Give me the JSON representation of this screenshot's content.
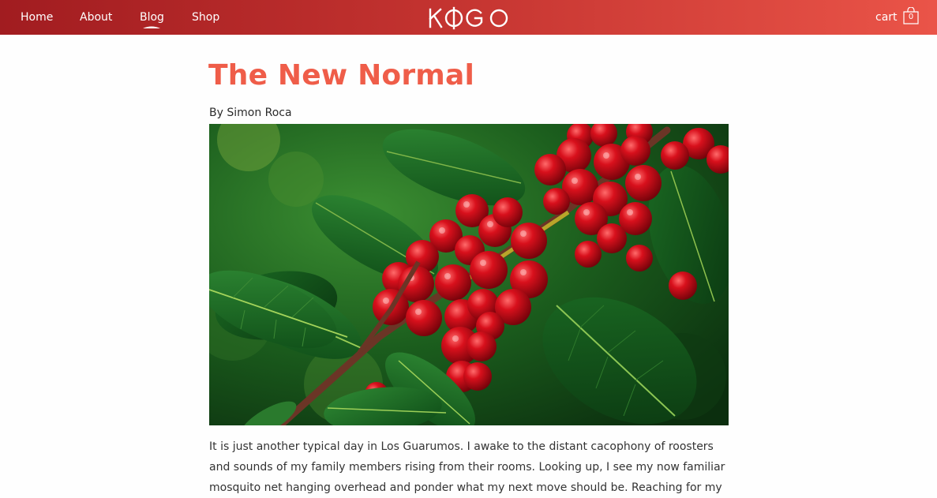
{
  "nav": {
    "items": [
      {
        "label": "Home"
      },
      {
        "label": "About"
      },
      {
        "label": "Blog",
        "active": true
      },
      {
        "label": "Shop"
      }
    ],
    "logo_text": "KOGO",
    "cart_label": "cart",
    "cart_count": "0"
  },
  "article": {
    "title": "The New Normal",
    "byline": "By Simon Roca",
    "paragraph": "It is just another typical day in Los Guarumos. I awake to the distant cacophony of roosters and sounds of my family members rising from their rooms. Looking up, I see my now familiar mosquito net hanging overhead and ponder what my next move should be. Reaching for my"
  },
  "colors": {
    "header_start": "#a11c20",
    "header_end": "#ea5448",
    "title": "#ef5d49"
  }
}
